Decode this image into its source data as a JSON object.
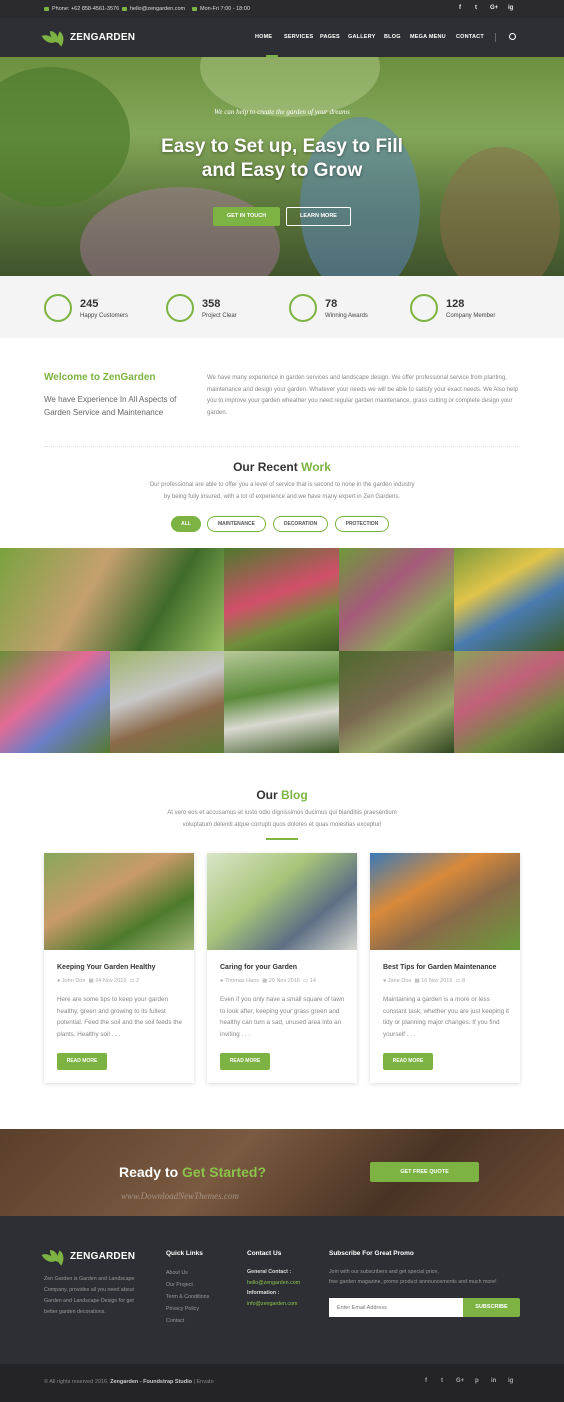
{
  "topbar": {
    "phone": "Phone: +62 858-4561-3576",
    "email": "hello@zengarden.com",
    "hours": "Mon-Fri 7:00 - 18:00",
    "social": [
      "f",
      "t",
      "G+",
      "ig"
    ]
  },
  "brand": {
    "name": "ZENGARDEN",
    "accent": "#7cb342"
  },
  "nav": {
    "items": [
      "HOME",
      "SERVICES",
      "PAGES",
      "GALLERY",
      "BLOG",
      "MEGA MENU",
      "CONTACT"
    ],
    "active": "HOME"
  },
  "hero": {
    "subtitle": "We can help to create the garden of your dreams",
    "title_line1": "Easy to Set up, Easy to Fill",
    "title_line2": "and Easy to Grow",
    "btn_primary": "GET IN TOUCH",
    "btn_secondary": "LEARN MORE"
  },
  "stats": [
    {
      "num": "245",
      "label": "Happy Customers",
      "icon": "people-icon"
    },
    {
      "num": "358",
      "label": "Project Clear",
      "icon": "flower-icon"
    },
    {
      "num": "78",
      "label": "Winning Awards",
      "icon": "award-icon"
    },
    {
      "num": "128",
      "label": "Company Member",
      "icon": "building-icon"
    }
  ],
  "welcome": {
    "title": "Welcome to ZenGarden",
    "subtitle": "We have Experience In All Aspects of Garden Service and Maintenance",
    "text": "We have many experience in garden services and landscape design. We offer professional service from planting, maintenance and design your garden. Whatever your needs we will be able to satisfy your exact needs. We Also help you to improve your garden wheather you need regular garden maintenance, grass cutting or complete design your garden."
  },
  "work": {
    "title_a": "Our Recent",
    "title_b": "Work",
    "text_line1": "Our professional are able to offer you a level of service that is second to none in the garden industry",
    "text_line2": "by being fully insured, with a lot of experience and we have many expert in Zen Gardens.",
    "filters": [
      "ALL",
      "MAINTENANCE",
      "DECORATION",
      "PROTECTION"
    ]
  },
  "blog": {
    "title_a": "Our",
    "title_b": "Blog",
    "text_line1": "At vero eos et accusamus et iusto odio dignissimos ducimus qui blanditiis praesentium",
    "text_line2": "voluptatum deleniti atque corrupti quos dolores et quas molestias excepturi",
    "posts": [
      {
        "title": "Keeping Your Garden Healthy",
        "author": "John Doe",
        "date": "24 Nov 2016",
        "comments": "2",
        "excerpt": "Here are some tips to keep your garden healthy, green and growing to its fullest potential. Feed the soil and the soil feeds the plants. Healthy soil . . .",
        "button": "READ MORE"
      },
      {
        "title": "Caring for your Garden",
        "author": "Thomas Hans",
        "date": "20 Nov 2016",
        "comments": "14",
        "excerpt": "Even if you only have a small square of lawn to look after, keeping your grass green and healthy can turn a sad, unused area into an inviting . . .",
        "button": "READ MORE"
      },
      {
        "title": "Best Tips for Garden Maintenance",
        "author": "Jane Doe",
        "date": "16 Nov 2016",
        "comments": "8",
        "excerpt": "Maintaining a garden is a more or less constant task, whether you are just keeping it tidy or planning major changes. If you find yourself . . .",
        "button": "READ MORE"
      }
    ]
  },
  "cta": {
    "title_a": "Ready to",
    "title_b": "Get Started?",
    "button": "GET FREE QUOTE",
    "watermark": "www.DownloadNewThemes.com"
  },
  "footer": {
    "about": "Zen Garden is Garden and Landscape Company, provides all you need about Garden and Landscape Design for get better garden decorations.",
    "quick_links_title": "Quick Links",
    "quick_links": [
      "About Us",
      "Our Project",
      "Term & Conditions",
      "Privacy Policy",
      "Contact"
    ],
    "contact_title": "Contact Us",
    "general_label": "General Contact :",
    "general_email": "hello@zengarden.com",
    "info_label": "Information :",
    "info_email": "info@zengarden.com",
    "subscribe_title": "Subscribe For Great Promo",
    "subscribe_line1": "Join with our subscribers and get special price,",
    "subscribe_line2": "free garden magazine, promo product announcements and much more!",
    "email_placeholder": "Enter Email Address",
    "subscribe_btn": "SUBSCRIBE"
  },
  "copyright": {
    "text": "© All rights reserved 2016.",
    "brand": "Zengarden - Foundstrap Studio",
    "suffix": "| Envato",
    "social": [
      "f",
      "t",
      "G+",
      "p",
      "in",
      "ig"
    ]
  }
}
